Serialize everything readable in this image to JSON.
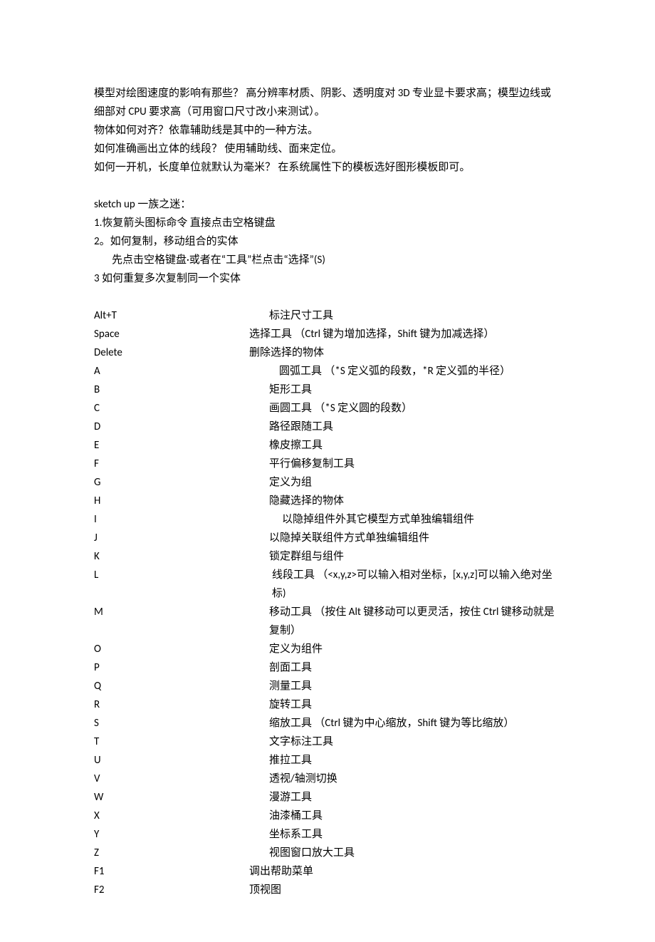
{
  "paragraphs": [
    "模型对绘图速度的影响有那些？   高分辨率材质、阴影、透明度对 3D 专业显卡要求高；模型边线或细部对 CPU 要求高（可用窗口尺寸改小来测试）。",
    "物体如何对齐？依靠辅助线是其中的一种方法。",
    "如何准确画出立体的线段？  使用辅助线、面来定位。",
    "如何一开机，长度单位就默认为毫米？  在系统属性下的模板选好图形模板即可。"
  ],
  "tips_title": "sketch up 一族之迷：",
  "tips": [
    "1.恢复箭头图标命令  直接点击空格键盘",
    "2。如何复制，移动组合的实体",
    "先点击空格键盘·或者在“工具”栏点击“选择”(S)",
    "3 如何重复多次复制同一个实体"
  ],
  "shortcuts": [
    {
      "key": "Alt+T",
      "desc": "标注尺寸工具"
    },
    {
      "key": "Space",
      "desc": "选择工具  （Ctrl 键为增加选择，Shift 键为加减选择）",
      "short": true
    },
    {
      "key": "Delete",
      "desc": "删除选择的物体",
      "short": true
    },
    {
      "key": "A",
      "desc": "圆弧工具  （*S 定义弧的段数，*R 定义弧的半径）",
      "cls": "desc-a"
    },
    {
      "key": "B",
      "desc": "矩形工具"
    },
    {
      "key": "C",
      "desc": "画圆工具  （*S 定义圆的段数）"
    },
    {
      "key": "D",
      "desc": "路径跟随工具"
    },
    {
      "key": "E",
      "desc": "橡皮擦工具"
    },
    {
      "key": "F",
      "desc": "平行偏移复制工具"
    },
    {
      "key": "G",
      "desc": "定义为组"
    },
    {
      "key": "H",
      "desc": "隐藏选择的物体"
    },
    {
      "key": "I",
      "desc": "以隐掉组件外其它模型方式单独编辑组件",
      "cls": "desc-i"
    },
    {
      "key": "J",
      "desc": "以隐掉关联组件方式单独编辑组件"
    },
    {
      "key": "K",
      "desc": "锁定群组与组件"
    },
    {
      "key": "L",
      "desc": "线段工具  （<x,y,z>可以输入相对坐标，[x,y,z]可以输入绝对坐标)",
      "cls": "desc-l"
    },
    {
      "key": "M",
      "desc": "移动工具  （按住 Alt 键移动可以更灵活，按住 Ctrl 键移动就是复制）"
    },
    {
      "key": "O",
      "desc": "定义为组件"
    },
    {
      "key": "P",
      "desc": "剖面工具"
    },
    {
      "key": "Q",
      "desc": "测量工具"
    },
    {
      "key": "R",
      "desc": "旋转工具"
    },
    {
      "key": "S",
      "desc": "缩放工具  （Ctrl 键为中心缩放，Shift 键为等比缩放）"
    },
    {
      "key": "T",
      "desc": "文字标注工具"
    },
    {
      "key": "U",
      "desc": "推拉工具"
    },
    {
      "key": "V",
      "desc": "透视/轴测切换"
    },
    {
      "key": "W",
      "desc": "漫游工具"
    },
    {
      "key": "X",
      "desc": "油漆桶工具"
    },
    {
      "key": "Y",
      "desc": "坐标系工具"
    },
    {
      "key": "Z",
      "desc": "视图窗口放大工具"
    },
    {
      "key": "F1",
      "desc": "调出帮助菜单",
      "short": true
    },
    {
      "key": "F2",
      "desc": "顶视图",
      "short": true
    }
  ]
}
